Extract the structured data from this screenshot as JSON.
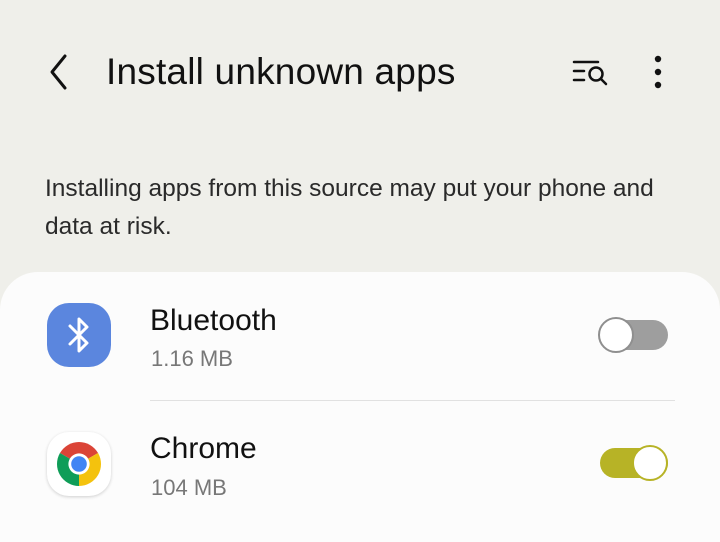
{
  "header": {
    "title": "Install unknown apps",
    "back_icon": "chevron-left-icon",
    "search_icon": "search-list-icon",
    "more_icon": "more-vertical-icon"
  },
  "description": {
    "text": "Installing apps from this source may put your phone and data at risk."
  },
  "apps": [
    {
      "name": "Bluetooth",
      "size": "1.16 MB",
      "icon": "bluetooth-icon",
      "enabled": false
    },
    {
      "name": "Chrome",
      "size": "104 MB",
      "icon": "chrome-icon",
      "enabled": true
    }
  ],
  "colors": {
    "background": "#efefea",
    "panel": "#fcfcfc",
    "toggle_on": "#b7b326",
    "toggle_off": "#9e9e9e",
    "bluetooth_icon_bg": "#5b86de"
  }
}
